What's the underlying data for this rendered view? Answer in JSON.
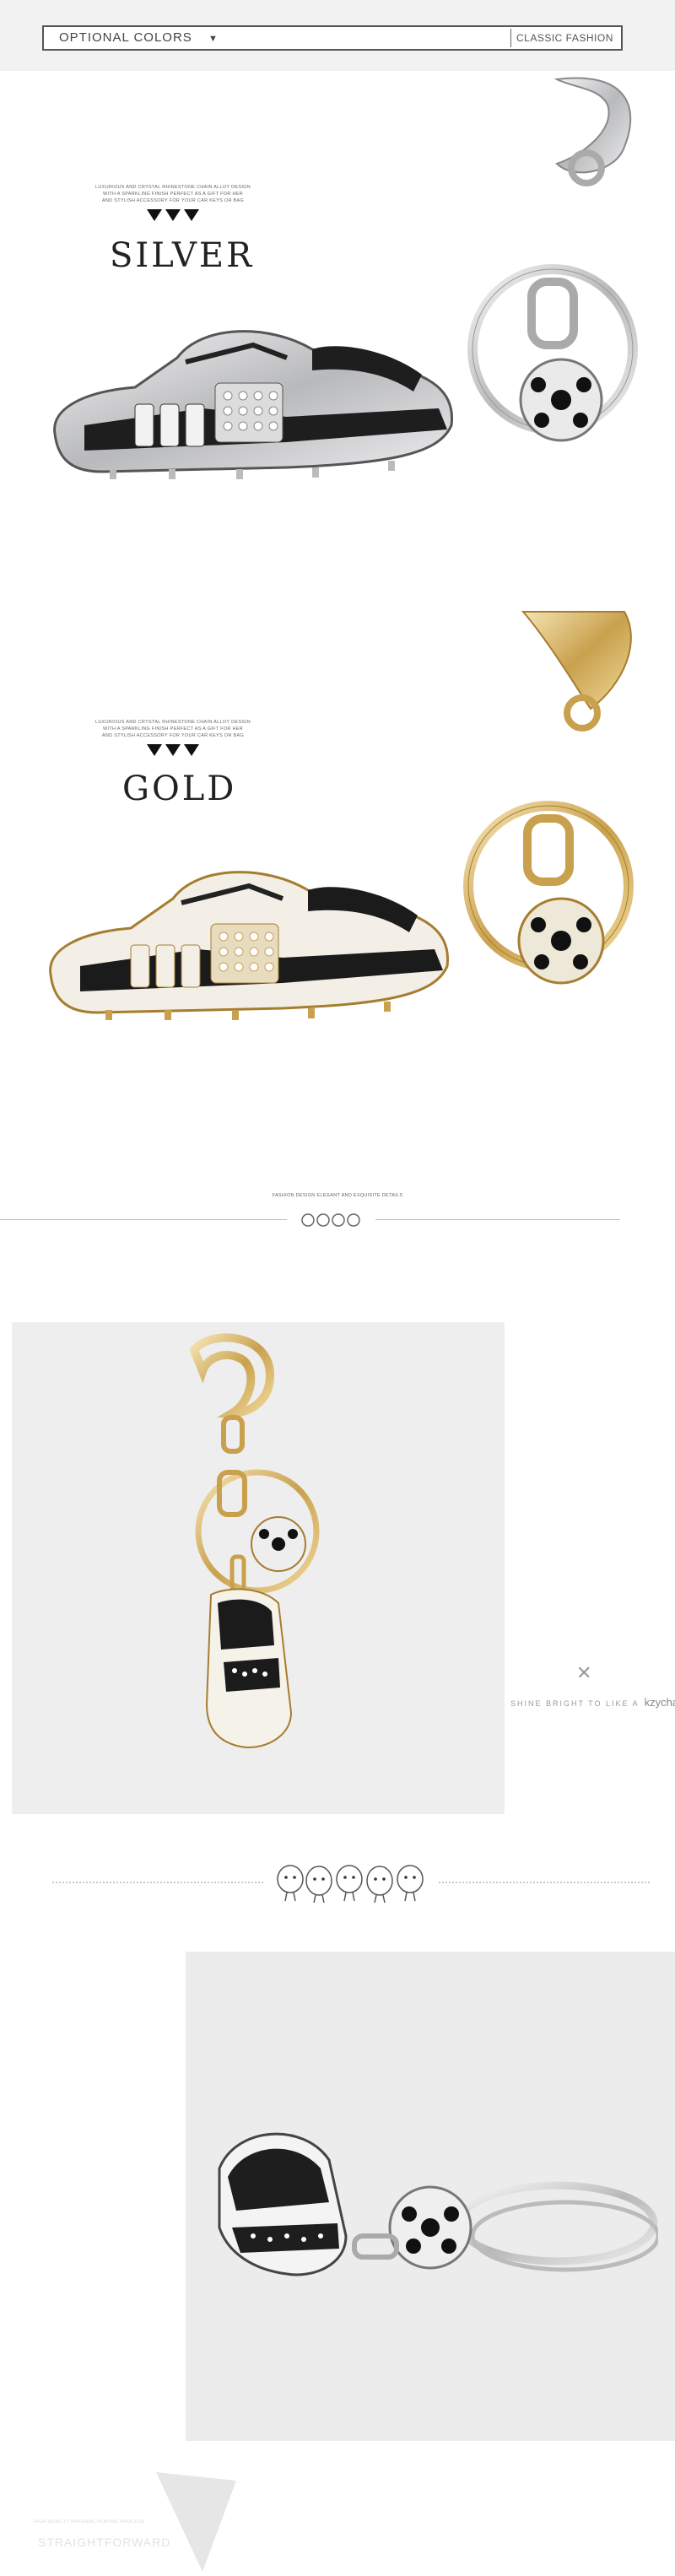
{
  "header": {
    "left_label": "OPTIONAL COLORS",
    "dropdown_icon": "caret-down-icon",
    "right_label": "CLASSIC FASHION"
  },
  "variants": [
    {
      "fine_print": [
        "LUXURIOUS AND CRYSTAL RHINESTONE CHAIN ALLOY DESIGN",
        "WITH A SPARKLING FINISH PERFECT AS A GIFT FOR HER",
        "AND STYLISH ACCESSORY FOR YOUR CAR KEYS OR BAG"
      ],
      "label": "SILVER",
      "metal_color": "#c8c9cb"
    },
    {
      "fine_print": [
        "LUXURIOUS AND CRYSTAL RHINESTONE CHAIN ALLOY DESIGN",
        "WITH A SPARKLING FINISH PERFECT AS A GIFT FOR HER",
        "AND STYLISH ACCESSORY FOR YOUR CAR KEYS OR BAG"
      ],
      "label": "GOLD",
      "metal_color": "#d8b56a"
    }
  ],
  "section_divider": {
    "fine_print": "FASHION DESIGN ELEGANT AND EXQUISITE DETAILS",
    "icon": "ornament-circles-icon"
  },
  "product_detail": {
    "close_icon": "close-icon",
    "caption_prefix": "SHINE BRIGHT TO LIKE A",
    "brand": "kzychain"
  },
  "cartoon_divider_icon": "cartoon-figures-icon",
  "footer": {
    "fine_print": "HIGH QUALITY MATERIAL PLATING PROCESS",
    "ghost_text": "STRAIGHTFORWARD"
  }
}
